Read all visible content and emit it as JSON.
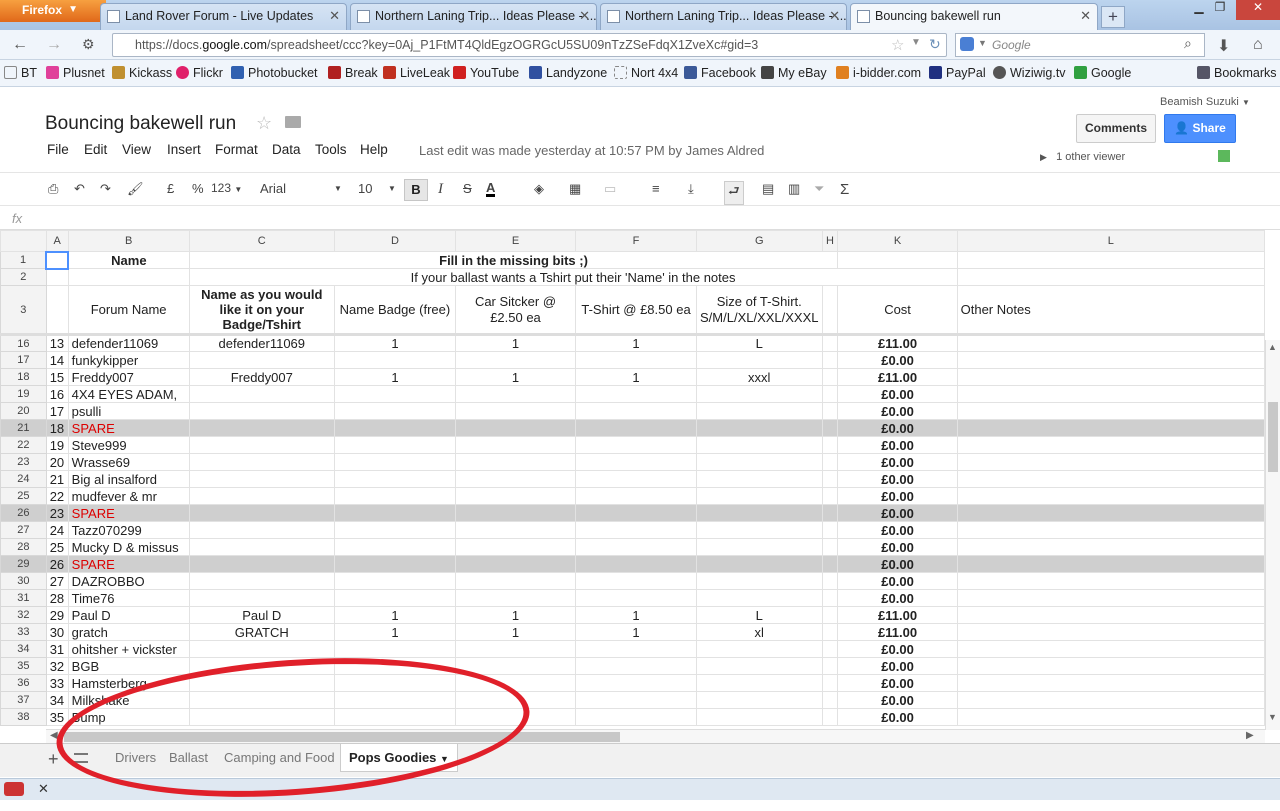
{
  "browser": {
    "menu_button": "Firefox",
    "tabs": [
      {
        "label": "Land Rover Forum - Live Updates"
      },
      {
        "label": "Northern Laning Trip... Ideas Please - ..."
      },
      {
        "label": "Northern Laning Trip... Ideas Please - ..."
      },
      {
        "label": "Bouncing bakewell run"
      }
    ],
    "url_prefix": "https://docs.",
    "url_domain": "google.com",
    "url_rest": "/spreadsheet/ccc?key=0Aj_P1FtMT4QldEgzOGRGcU5SU09nTzZSeFdqX1ZveXc#gid=3",
    "search_placeholder": "Google",
    "bookmarks": [
      {
        "label": "BT",
        "color": "#ffffff"
      },
      {
        "label": "Plusnet",
        "color": "#e0409a"
      },
      {
        "label": "Kickass",
        "color": "#c09030"
      },
      {
        "label": "Flickr",
        "color": "#e0206a"
      },
      {
        "label": "Photobucket",
        "color": "#3060b0"
      },
      {
        "label": "Break",
        "color": "#b02020"
      },
      {
        "label": "LiveLeak",
        "color": "#c03020"
      },
      {
        "label": "YouTube",
        "color": "#d02020"
      },
      {
        "label": "Landyzone",
        "color": "#3050a0"
      },
      {
        "label": "Nort 4x4",
        "color": "#ffffff"
      },
      {
        "label": "Facebook",
        "color": "#3b5998"
      },
      {
        "label": "My eBay",
        "color": "#444444"
      },
      {
        "label": "i-bidder.com",
        "color": "#e08020"
      },
      {
        "label": "PayPal",
        "color": "#203080"
      },
      {
        "label": "Wiziwig.tv",
        "color": "#555555"
      },
      {
        "label": "Google",
        "color": "#30a040"
      }
    ],
    "bookmarks_menu": "Bookmarks"
  },
  "doc": {
    "title": "Bouncing bakewell run",
    "user": "Beamish Suzuki",
    "menus": [
      "File",
      "Edit",
      "View",
      "Insert",
      "Format",
      "Data",
      "Tools",
      "Help"
    ],
    "last_edit": "Last edit was made yesterday at 10:57 PM by James Aldred",
    "comments_label": "Comments",
    "share_label": "Share",
    "viewers": "1 other viewer"
  },
  "toolbar": {
    "currency": "£",
    "percent": "%",
    "number_format": "123",
    "font": "Arial",
    "font_size": "10",
    "bold": "B",
    "italic": "I",
    "strike": "S",
    "text_color": "A",
    "formula_icon": "fx",
    "sigma": "Σ"
  },
  "sheet": {
    "col_headers": [
      "A",
      "B",
      "C",
      "D",
      "E",
      "F",
      "G",
      "H",
      "K",
      "L"
    ],
    "row1_name": "Name",
    "row1_title": "Fill in the missing bits ;)",
    "row2_note": "If your ballast wants a Tshirt put their 'Name' in the notes",
    "headers": {
      "forum_name": "Forum Name",
      "badge_name": "Name as you would like it on your Badge/Tshirt",
      "name_badge": "Name Badge (free)",
      "car_sticker": "Car Sitcker @ £2.50 ea",
      "tshirt": "T-Shirt @ £8.50 ea",
      "size": "Size of T-Shirt. S/M/L/XL/XXL/XXXL",
      "cost": "Cost",
      "notes": "Other Notes"
    },
    "rows": [
      {
        "row": "16",
        "a": "13",
        "b": "defender11069",
        "c": "defender11069",
        "d": "1",
        "e": "1",
        "f": "1",
        "g": "L",
        "k": "£11.00",
        "spare": false
      },
      {
        "row": "17",
        "a": "14",
        "b": "funkykipper",
        "c": "",
        "d": "",
        "e": "",
        "f": "",
        "g": "",
        "k": "£0.00",
        "spare": false
      },
      {
        "row": "18",
        "a": "15",
        "b": "Freddy007",
        "c": "Freddy007",
        "d": "1",
        "e": "1",
        "f": "1",
        "g": "xxxl",
        "k": "£11.00",
        "spare": false
      },
      {
        "row": "19",
        "a": "16",
        "b": "4X4 EYES ADAM,",
        "c": "",
        "d": "",
        "e": "",
        "f": "",
        "g": "",
        "k": "£0.00",
        "spare": false
      },
      {
        "row": "20",
        "a": "17",
        "b": "psulli",
        "c": "",
        "d": "",
        "e": "",
        "f": "",
        "g": "",
        "k": "£0.00",
        "spare": false
      },
      {
        "row": "21",
        "a": "18",
        "b": "SPARE",
        "c": "",
        "d": "",
        "e": "",
        "f": "",
        "g": "",
        "k": "£0.00",
        "spare": true
      },
      {
        "row": "22",
        "a": "19",
        "b": "Steve999",
        "c": "",
        "d": "",
        "e": "",
        "f": "",
        "g": "",
        "k": "£0.00",
        "spare": false
      },
      {
        "row": "23",
        "a": "20",
        "b": "Wrasse69",
        "c": "",
        "d": "",
        "e": "",
        "f": "",
        "g": "",
        "k": "£0.00",
        "spare": false
      },
      {
        "row": "24",
        "a": "21",
        "b": "Big al insalford",
        "c": "",
        "d": "",
        "e": "",
        "f": "",
        "g": "",
        "k": "£0.00",
        "spare": false
      },
      {
        "row": "25",
        "a": "22",
        "b": "mudfever & mr",
        "c": "",
        "d": "",
        "e": "",
        "f": "",
        "g": "",
        "k": "£0.00",
        "spare": false
      },
      {
        "row": "26",
        "a": "23",
        "b": "SPARE",
        "c": "",
        "d": "",
        "e": "",
        "f": "",
        "g": "",
        "k": "£0.00",
        "spare": true
      },
      {
        "row": "27",
        "a": "24",
        "b": "Tazz070299",
        "c": "",
        "d": "",
        "e": "",
        "f": "",
        "g": "",
        "k": "£0.00",
        "spare": false
      },
      {
        "row": "28",
        "a": "25",
        "b": "Mucky D & missus",
        "c": "",
        "d": "",
        "e": "",
        "f": "",
        "g": "",
        "k": "£0.00",
        "spare": false
      },
      {
        "row": "29",
        "a": "26",
        "b": "SPARE",
        "c": "",
        "d": "",
        "e": "",
        "f": "",
        "g": "",
        "k": "£0.00",
        "spare": true
      },
      {
        "row": "30",
        "a": "27",
        "b": "DAZROBBO",
        "c": "",
        "d": "",
        "e": "",
        "f": "",
        "g": "",
        "k": "£0.00",
        "spare": false
      },
      {
        "row": "31",
        "a": "28",
        "b": "Time76",
        "c": "",
        "d": "",
        "e": "",
        "f": "",
        "g": "",
        "k": "£0.00",
        "spare": false
      },
      {
        "row": "32",
        "a": "29",
        "b": "Paul D",
        "c": "Paul D",
        "d": "1",
        "e": "1",
        "f": "1",
        "g": "L",
        "k": "£11.00",
        "spare": false
      },
      {
        "row": "33",
        "a": "30",
        "b": "gratch",
        "c": "GRATCH",
        "d": "1",
        "e": "1",
        "f": "1",
        "g": "xl",
        "k": "£11.00",
        "spare": false
      },
      {
        "row": "34",
        "a": "31",
        "b": "ohitsher + vickster",
        "c": "",
        "d": "",
        "e": "",
        "f": "",
        "g": "",
        "k": "£0.00",
        "spare": false
      },
      {
        "row": "35",
        "a": "32",
        "b": "BGB",
        "c": "",
        "d": "",
        "e": "",
        "f": "",
        "g": "",
        "k": "£0.00",
        "spare": false
      },
      {
        "row": "36",
        "a": "33",
        "b": "Hamsterberg",
        "c": "",
        "d": "",
        "e": "",
        "f": "",
        "g": "",
        "k": "£0.00",
        "spare": false
      },
      {
        "row": "37",
        "a": "34",
        "b": "Milkshake",
        "c": "",
        "d": "",
        "e": "",
        "f": "",
        "g": "",
        "k": "£0.00",
        "spare": false
      },
      {
        "row": "38",
        "a": "35",
        "b": "Bump",
        "c": "",
        "d": "",
        "e": "",
        "f": "",
        "g": "",
        "k": "£0.00",
        "spare": false
      }
    ]
  },
  "sheet_tabs": [
    {
      "label": "Drivers",
      "active": false
    },
    {
      "label": "Ballast",
      "active": false
    },
    {
      "label": "Camping and Food",
      "active": false
    },
    {
      "label": "Pops Goodies",
      "active": true
    }
  ],
  "annotation_color": "#e0202a"
}
